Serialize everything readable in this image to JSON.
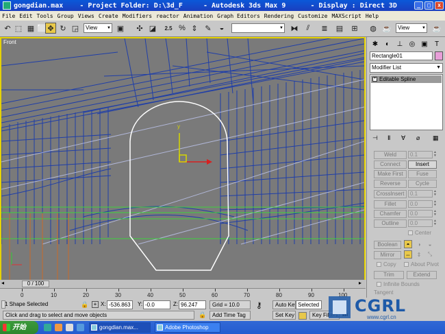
{
  "window": {
    "title": "gongdian.max    - Project Folder: D:\\3d_F     - Autodesk 3ds Max 9      - Display : Direct 3D"
  },
  "menu": [
    "File",
    "Edit",
    "Tools",
    "Group",
    "Views",
    "Create",
    "Modifiers",
    "reactor",
    "Animation",
    "Graph Editors",
    "Rendering",
    "Customize",
    "MAXScript",
    "Help"
  ],
  "toolbar": {
    "view_dropdown": "View",
    "view_dropdown_right": "View",
    "snap_angle": "2.5",
    "percent_snap": "%",
    "named_selection": ""
  },
  "viewport": {
    "label": "Front",
    "gizmo_y": "y"
  },
  "command_panel": {
    "object_name": "Rectangle01",
    "modifier_list": "Modifier List",
    "stack_item": "Editable Spline",
    "rollout": {
      "weld_label": "Weld",
      "weld_value": "0.1",
      "connect_label": "Connect",
      "insert_label": "Insert",
      "make_first_label": "Make First",
      "fuse_label": "Fuse",
      "reverse_label": "Reverse",
      "cycle_label": "Cycle",
      "crossinsert_label": "CrossInsert",
      "crossinsert_value": "0.1",
      "fillet_label": "Fillet",
      "fillet_value": "0.0",
      "chamfer_label": "Chamfer",
      "chamfer_value": "0.0",
      "outline_label": "Outline",
      "outline_value": "0.0",
      "center_label": "Center",
      "boolean_label": "Boolean",
      "mirror_label": "Mirror",
      "copy_label": "Copy",
      "about_pivot_label": "About Pivot",
      "trim_label": "Trim",
      "extend_label": "Extend",
      "infinite_bounds_label": "Infinite Bounds",
      "tangent_label": "Tangent"
    }
  },
  "timeline": {
    "slider": "0 / 100",
    "ticks": [
      "0",
      "10",
      "20",
      "30",
      "40",
      "50",
      "60",
      "70",
      "80",
      "90",
      "100"
    ]
  },
  "status": {
    "selection": "1 Shape Selected",
    "prompt": "Click and drag to select and move objects",
    "x_label": "X:",
    "x_value": "-536.863",
    "y_label": "Y:",
    "y_value": "-0.0",
    "z_label": "Z:",
    "z_value": "96.247",
    "grid": "Grid = 10.0",
    "add_time_tag": "Add Time Tag",
    "auto_key": "Auto Key",
    "auto_key_mode": "Selected",
    "set_key": "Set Key",
    "key_filters": "Key Filters..."
  },
  "taskbar": {
    "start": "开始",
    "tasks": [
      "gongdian.max...",
      "Adobe Photoshop"
    ]
  },
  "watermark": {
    "brand": "CGRL",
    "url": "www.cgrl.cn"
  },
  "colors": {
    "wireframe_blue": "#1f3ea8",
    "spline_white": "#ffffff",
    "viewport_bg": "#7a7a7a",
    "active_border": "#e6d200",
    "grid_green": "#3cd23c",
    "orange_lines": "#c86a2a"
  }
}
